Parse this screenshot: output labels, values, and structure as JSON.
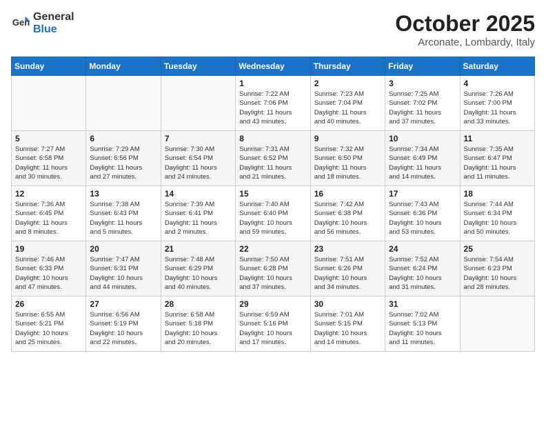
{
  "header": {
    "logo_line1": "General",
    "logo_line2": "Blue",
    "month": "October 2025",
    "location": "Arconate, Lombardy, Italy"
  },
  "weekdays": [
    "Sunday",
    "Monday",
    "Tuesday",
    "Wednesday",
    "Thursday",
    "Friday",
    "Saturday"
  ],
  "weeks": [
    [
      {
        "day": "",
        "info": ""
      },
      {
        "day": "",
        "info": ""
      },
      {
        "day": "",
        "info": ""
      },
      {
        "day": "1",
        "info": "Sunrise: 7:22 AM\nSunset: 7:06 PM\nDaylight: 11 hours\nand 43 minutes."
      },
      {
        "day": "2",
        "info": "Sunrise: 7:23 AM\nSunset: 7:04 PM\nDaylight: 11 hours\nand 40 minutes."
      },
      {
        "day": "3",
        "info": "Sunrise: 7:25 AM\nSunset: 7:02 PM\nDaylight: 11 hours\nand 37 minutes."
      },
      {
        "day": "4",
        "info": "Sunrise: 7:26 AM\nSunset: 7:00 PM\nDaylight: 11 hours\nand 33 minutes."
      }
    ],
    [
      {
        "day": "5",
        "info": "Sunrise: 7:27 AM\nSunset: 6:58 PM\nDaylight: 11 hours\nand 30 minutes."
      },
      {
        "day": "6",
        "info": "Sunrise: 7:29 AM\nSunset: 6:56 PM\nDaylight: 11 hours\nand 27 minutes."
      },
      {
        "day": "7",
        "info": "Sunrise: 7:30 AM\nSunset: 6:54 PM\nDaylight: 11 hours\nand 24 minutes."
      },
      {
        "day": "8",
        "info": "Sunrise: 7:31 AM\nSunset: 6:52 PM\nDaylight: 11 hours\nand 21 minutes."
      },
      {
        "day": "9",
        "info": "Sunrise: 7:32 AM\nSunset: 6:50 PM\nDaylight: 11 hours\nand 18 minutes."
      },
      {
        "day": "10",
        "info": "Sunrise: 7:34 AM\nSunset: 6:49 PM\nDaylight: 11 hours\nand 14 minutes."
      },
      {
        "day": "11",
        "info": "Sunrise: 7:35 AM\nSunset: 6:47 PM\nDaylight: 11 hours\nand 11 minutes."
      }
    ],
    [
      {
        "day": "12",
        "info": "Sunrise: 7:36 AM\nSunset: 6:45 PM\nDaylight: 11 hours\nand 8 minutes."
      },
      {
        "day": "13",
        "info": "Sunrise: 7:38 AM\nSunset: 6:43 PM\nDaylight: 11 hours\nand 5 minutes."
      },
      {
        "day": "14",
        "info": "Sunrise: 7:39 AM\nSunset: 6:41 PM\nDaylight: 11 hours\nand 2 minutes."
      },
      {
        "day": "15",
        "info": "Sunrise: 7:40 AM\nSunset: 6:40 PM\nDaylight: 10 hours\nand 59 minutes."
      },
      {
        "day": "16",
        "info": "Sunrise: 7:42 AM\nSunset: 6:38 PM\nDaylight: 10 hours\nand 56 minutes."
      },
      {
        "day": "17",
        "info": "Sunrise: 7:43 AM\nSunset: 6:36 PM\nDaylight: 10 hours\nand 53 minutes."
      },
      {
        "day": "18",
        "info": "Sunrise: 7:44 AM\nSunset: 6:34 PM\nDaylight: 10 hours\nand 50 minutes."
      }
    ],
    [
      {
        "day": "19",
        "info": "Sunrise: 7:46 AM\nSunset: 6:33 PM\nDaylight: 10 hours\nand 47 minutes."
      },
      {
        "day": "20",
        "info": "Sunrise: 7:47 AM\nSunset: 6:31 PM\nDaylight: 10 hours\nand 44 minutes."
      },
      {
        "day": "21",
        "info": "Sunrise: 7:48 AM\nSunset: 6:29 PM\nDaylight: 10 hours\nand 40 minutes."
      },
      {
        "day": "22",
        "info": "Sunrise: 7:50 AM\nSunset: 6:28 PM\nDaylight: 10 hours\nand 37 minutes."
      },
      {
        "day": "23",
        "info": "Sunrise: 7:51 AM\nSunset: 6:26 PM\nDaylight: 10 hours\nand 34 minutes."
      },
      {
        "day": "24",
        "info": "Sunrise: 7:52 AM\nSunset: 6:24 PM\nDaylight: 10 hours\nand 31 minutes."
      },
      {
        "day": "25",
        "info": "Sunrise: 7:54 AM\nSunset: 6:23 PM\nDaylight: 10 hours\nand 28 minutes."
      }
    ],
    [
      {
        "day": "26",
        "info": "Sunrise: 6:55 AM\nSunset: 5:21 PM\nDaylight: 10 hours\nand 25 minutes."
      },
      {
        "day": "27",
        "info": "Sunrise: 6:56 AM\nSunset: 5:19 PM\nDaylight: 10 hours\nand 22 minutes."
      },
      {
        "day": "28",
        "info": "Sunrise: 6:58 AM\nSunset: 5:18 PM\nDaylight: 10 hours\nand 20 minutes."
      },
      {
        "day": "29",
        "info": "Sunrise: 6:59 AM\nSunset: 5:16 PM\nDaylight: 10 hours\nand 17 minutes."
      },
      {
        "day": "30",
        "info": "Sunrise: 7:01 AM\nSunset: 5:15 PM\nDaylight: 10 hours\nand 14 minutes."
      },
      {
        "day": "31",
        "info": "Sunrise: 7:02 AM\nSunset: 5:13 PM\nDaylight: 10 hours\nand 11 minutes."
      },
      {
        "day": "",
        "info": ""
      }
    ]
  ]
}
